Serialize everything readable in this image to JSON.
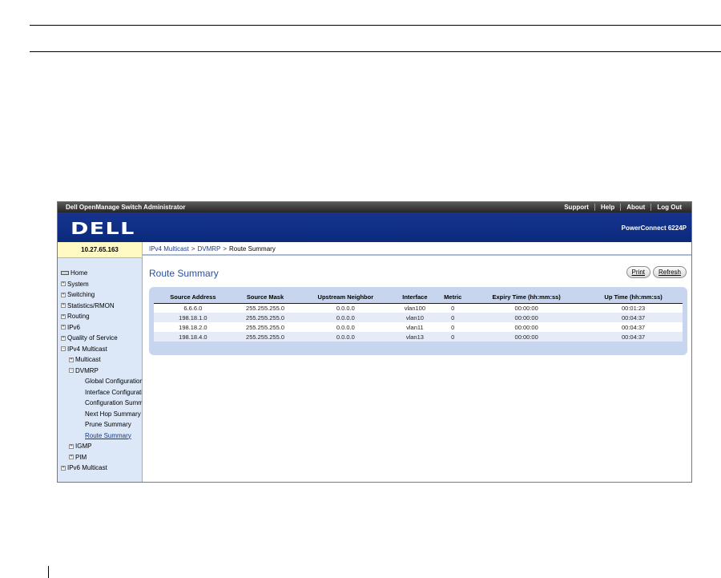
{
  "app": {
    "title": "Dell OpenManage Switch Administrator",
    "top_links": [
      "Support",
      "Help",
      "About",
      "Log Out"
    ],
    "logo": "DELL",
    "product": "PowerConnect 6224P"
  },
  "ip_address": "10.27.65.163",
  "breadcrumb": {
    "items": [
      "IPv4 Multicast",
      "DVMRP",
      "Route Summary"
    ],
    "separator": ">"
  },
  "sidebar": {
    "items": [
      {
        "label": "Home",
        "toggle": ""
      },
      {
        "label": "System",
        "toggle": "+"
      },
      {
        "label": "Switching",
        "toggle": "+"
      },
      {
        "label": "Statistics/RMON",
        "toggle": "+"
      },
      {
        "label": "Routing",
        "toggle": "+"
      },
      {
        "label": "IPv6",
        "toggle": "+"
      },
      {
        "label": "Quality of Service",
        "toggle": "+"
      },
      {
        "label": "IPv4 Multicast",
        "toggle": "−"
      },
      {
        "label": "Multicast",
        "toggle": "+"
      },
      {
        "label": "DVMRP",
        "toggle": "−"
      },
      {
        "label": "Global Configuration",
        "toggle": ""
      },
      {
        "label": "Interface Configuration",
        "toggle": ""
      },
      {
        "label": "Configuration Summary",
        "toggle": ""
      },
      {
        "label": "Next Hop Summary",
        "toggle": ""
      },
      {
        "label": "Prune Summary",
        "toggle": ""
      },
      {
        "label": "Route Summary",
        "toggle": ""
      },
      {
        "label": "IGMP",
        "toggle": "+"
      },
      {
        "label": "PIM",
        "toggle": "+"
      },
      {
        "label": "IPv6 Multicast",
        "toggle": "+"
      }
    ]
  },
  "main": {
    "title": "Route Summary",
    "buttons": {
      "print": "Print",
      "refresh": "Refresh"
    },
    "table": {
      "headers": [
        "Source Address",
        "Source Mask",
        "Upstream Neighbor",
        "Interface",
        "Metric",
        "Expiry Time (hh:mm:ss)",
        "Up Time (hh:mm:ss)"
      ],
      "rows": [
        [
          "6.6.6.0",
          "255.255.255.0",
          "0.0.0.0",
          "vlan100",
          "0",
          "00:00:00",
          "00:01:23"
        ],
        [
          "198.18.1.0",
          "255.255.255.0",
          "0.0.0.0",
          "vlan10",
          "0",
          "00:00:00",
          "00:04:37"
        ],
        [
          "198.18.2.0",
          "255.255.255.0",
          "0.0.0.0",
          "vlan11",
          "0",
          "00:00:00",
          "00:04:37"
        ],
        [
          "198.18.4.0",
          "255.255.255.0",
          "0.0.0.0",
          "vlan13",
          "0",
          "00:00:00",
          "00:04:37"
        ]
      ]
    }
  }
}
